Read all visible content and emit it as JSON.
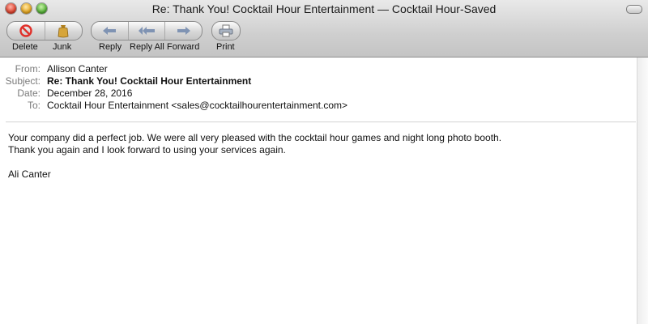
{
  "window": {
    "title": "Re: Thank You! Cocktail Hour Entertainment — Cocktail Hour-Saved"
  },
  "toolbar": {
    "delete_label": "Delete",
    "junk_label": "Junk",
    "reply_label": "Reply",
    "reply_all_label": "Reply All",
    "forward_label": "Forward",
    "print_label": "Print"
  },
  "header": {
    "from_key": "From:",
    "from_value": "Allison Canter",
    "subject_key": "Subject:",
    "subject_value": "Re: Thank You! Cocktail Hour Entertainment",
    "date_key": "Date:",
    "date_value": "December 28, 2016",
    "to_key": "To:",
    "to_value": "Cocktail Hour Entertainment <sales@cocktailhourentertainment.com>"
  },
  "message": {
    "line1": "Your company did a perfect job. We were all very pleased with the cocktail hour games and night long photo booth.",
    "line2": "Thank you again and I look forward to using your services again.",
    "signature": "Ali Canter"
  },
  "colors": {
    "delete_icon": "#e0302a",
    "junk_icon": "#c89a2c",
    "arrow_icon": "#7f93b3"
  }
}
